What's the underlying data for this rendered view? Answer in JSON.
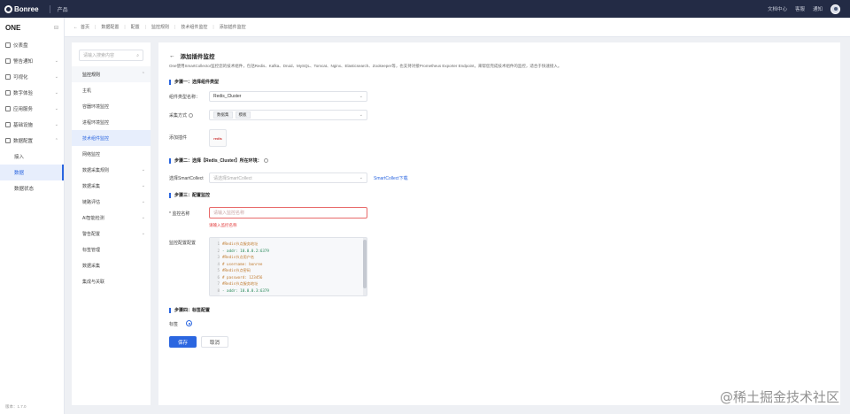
{
  "topbar": {
    "logo_text": "Bonree",
    "product": "产品",
    "right_items": [
      "文档中心",
      "客服",
      "通知"
    ]
  },
  "sidebar": {
    "title": "ONE",
    "items": [
      {
        "label": "仪表盘"
      },
      {
        "label": "警告通知"
      },
      {
        "label": "可视化"
      },
      {
        "label": "数字体验"
      },
      {
        "label": "应用服务"
      },
      {
        "label": "基础设施"
      },
      {
        "label": "数据配置"
      }
    ],
    "sub_items": [
      {
        "label": "接入"
      },
      {
        "label": "数据",
        "active": true
      },
      {
        "label": "数据状态"
      }
    ],
    "footer": "版本：1.7.0"
  },
  "breadcrumb": [
    "首页",
    "数据配置",
    "配置",
    "监控规则",
    "技术组件监控",
    "添加插件监控"
  ],
  "content_nav": {
    "search_placeholder": "请输入搜索内容",
    "rows": [
      {
        "label": "监控规则",
        "group": true
      },
      {
        "label": "主机"
      },
      {
        "label": "容器环境监控"
      },
      {
        "label": "进程环境监控"
      },
      {
        "label": "技术组件监控",
        "active": true
      },
      {
        "label": "网络监控"
      },
      {
        "label": "数据采集规则",
        "chev": true
      },
      {
        "label": "数据采集",
        "chev": true
      },
      {
        "label": "链路评估",
        "chev": true
      },
      {
        "label": "AI智能检测",
        "chev": true
      },
      {
        "label": "警告配置",
        "chev": true
      },
      {
        "label": "标签管理"
      },
      {
        "label": "数据采集"
      },
      {
        "label": "集成与关联"
      }
    ]
  },
  "form": {
    "title": "添加插件监控",
    "description": "One使用SmartCollector监控您的技术组件，包括Redis、Kafka、Druid、MySQL、Tomcat、Nginx、Elasticsearch、Zookeeper等，也支持对接Prometheus Exporter Endpoint，来帮您完成技术组件的监控，适合于快速接入。",
    "step1": "步骤一：选择组件类型",
    "component_type_label": "组件类型名称：",
    "component_type_value": "Redis_Cluster",
    "collect_method_label": "采集方式",
    "tag1": "数据集",
    "tag2": "模板",
    "plugin_label": "添加插件",
    "plugin_logo": "redis",
    "step2": "步骤二：选择【Redis_Cluster】所在环境：",
    "smartcollect_label": "选择SmartCollect",
    "smartcollect_placeholder": "请选择SmartCollect",
    "smartcollect_link": "SmartCollect下载",
    "step3": "步骤三：配置监控",
    "monitor_name_label": "* 监控名称",
    "monitor_name_placeholder": "请输入监控名称",
    "monitor_name_error": "请输入监控名称",
    "config_label": "监控配置配置",
    "code_lines": [
      {
        "n": "1",
        "text": "#Redis节点服务地址",
        "cls": "c"
      },
      {
        "n": "2",
        "text": "- addr: 10.0.0.2:6379",
        "cls": "v"
      },
      {
        "n": "3",
        "text": "#Redis节点用户名",
        "cls": "c"
      },
      {
        "n": "4",
        "text": "# username: bonree",
        "cls": "c"
      },
      {
        "n": "5",
        "text": "#Redis节点密码",
        "cls": "c"
      },
      {
        "n": "6",
        "text": "# password: 123456",
        "cls": "c"
      },
      {
        "n": "7",
        "text": "#Redis节点服务地址",
        "cls": "c"
      },
      {
        "n": "8",
        "text": "- addr: 10.0.0.3:6379",
        "cls": "v"
      }
    ],
    "step4": "步骤四：标签配置",
    "tag_label": "标签",
    "confirm_button": "保存",
    "cancel_button": "取消"
  },
  "watermark": "@稀土掘金技术社区",
  "colors": {
    "accent": "#2b66e0",
    "topbar": "#232b45",
    "error": "#e23c3c"
  }
}
